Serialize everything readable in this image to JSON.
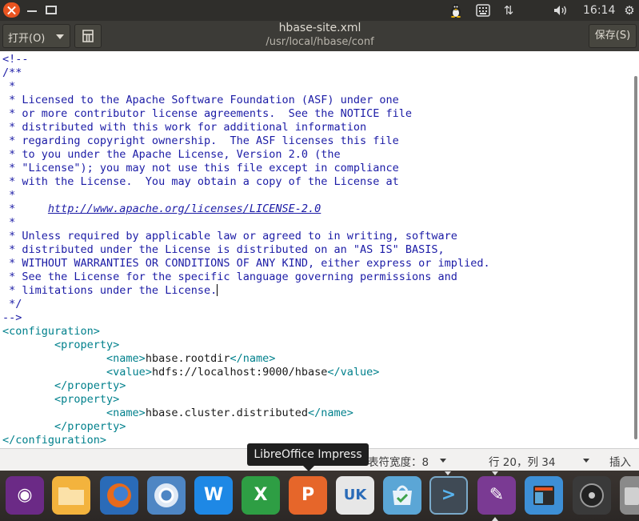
{
  "panel": {
    "clock": "16:14",
    "icons": [
      "tux-icon",
      "keyboard-icon",
      "network-icon",
      "volume-icon",
      "gear-icon"
    ]
  },
  "header": {
    "open_label": "打开(O)",
    "save_label": "保存(S)",
    "title": "hbase-site.xml",
    "subtitle": "/usr/local/hbase/conf"
  },
  "editor": {
    "lines": [
      [
        {
          "t": "<!--",
          "c": "cmt"
        }
      ],
      [
        {
          "t": "/**",
          "c": "cmt"
        }
      ],
      [
        {
          "t": " *",
          "c": "cmt"
        }
      ],
      [
        {
          "t": " * Licensed to the Apache Software Foundation (ASF) under one",
          "c": "cmt"
        }
      ],
      [
        {
          "t": " * or more contributor license agreements.  See the NOTICE file",
          "c": "cmt"
        }
      ],
      [
        {
          "t": " * distributed with this work for additional information",
          "c": "cmt"
        }
      ],
      [
        {
          "t": " * regarding copyright ownership.  The ASF licenses this file",
          "c": "cmt"
        }
      ],
      [
        {
          "t": " * to you under the Apache License, Version 2.0 (the",
          "c": "cmt"
        }
      ],
      [
        {
          "t": " * \"License\"); you may not use this file except in compliance",
          "c": "cmt"
        }
      ],
      [
        {
          "t": " * with the License.  You may obtain a copy of the License at",
          "c": "cmt"
        }
      ],
      [
        {
          "t": " *",
          "c": "cmt"
        }
      ],
      [
        {
          "t": " *     ",
          "c": "cmt"
        },
        {
          "t": "http://www.apache.org/licenses/LICENSE-2.0",
          "c": "lnk"
        }
      ],
      [
        {
          "t": " *",
          "c": "cmt"
        }
      ],
      [
        {
          "t": " * Unless required by applicable law or agreed to in writing, software",
          "c": "cmt"
        }
      ],
      [
        {
          "t": " * distributed under the License is distributed on an \"AS IS\" BASIS,",
          "c": "cmt"
        }
      ],
      [
        {
          "t": " * WITHOUT WARRANTIES OR CONDITIONS OF ANY KIND, either express or implied.",
          "c": "cmt"
        }
      ],
      [
        {
          "t": " * See the License for the specific language governing permissions and",
          "c": "cmt"
        }
      ],
      [
        {
          "t": " * limitations under the License.",
          "c": "cmt"
        },
        {
          "cursor": true
        }
      ],
      [
        {
          "t": " */",
          "c": "cmt"
        }
      ],
      [
        {
          "t": "-->",
          "c": "cmt"
        }
      ],
      [
        {
          "t": "<configuration>",
          "c": "tag"
        }
      ],
      [
        {
          "t": "        ",
          "c": "txt"
        },
        {
          "t": "<property>",
          "c": "tag"
        }
      ],
      [
        {
          "t": "                ",
          "c": "txt"
        },
        {
          "t": "<name>",
          "c": "tag"
        },
        {
          "t": "hbase.rootdir",
          "c": "txt"
        },
        {
          "t": "</name>",
          "c": "tag"
        }
      ],
      [
        {
          "t": "                ",
          "c": "txt"
        },
        {
          "t": "<value>",
          "c": "tag"
        },
        {
          "t": "hdfs://localhost:9000/hbase",
          "c": "txt"
        },
        {
          "t": "</value>",
          "c": "tag"
        }
      ],
      [
        {
          "t": "        ",
          "c": "txt"
        },
        {
          "t": "</property>",
          "c": "tag"
        }
      ],
      [
        {
          "t": "        ",
          "c": "txt"
        },
        {
          "t": "<property>",
          "c": "tag"
        }
      ],
      [
        {
          "t": "                ",
          "c": "txt"
        },
        {
          "t": "<name>",
          "c": "tag"
        },
        {
          "t": "hbase.cluster.distributed",
          "c": "txt"
        },
        {
          "t": "</name>",
          "c": "tag"
        }
      ],
      [
        {
          "t": "        ",
          "c": "txt"
        },
        {
          "t": "</property>",
          "c": "tag"
        }
      ],
      [
        {
          "t": "</configuration>",
          "c": "tag"
        }
      ]
    ]
  },
  "status": {
    "tab_width": "表符宽度：8",
    "position": "行 20，列 34",
    "mode": "插入"
  },
  "tooltip": "LibreOffice Impress",
  "dock": {
    "writer_glyph": "W",
    "calc_glyph": "X",
    "impress_glyph": "P",
    "langtool_glyph": "UK",
    "terminal_glyph": ">",
    "ubuntu_glyph": "◉",
    "pen_glyph": "✎"
  },
  "colors": {
    "comment": "#1b1ba6",
    "tag": "#00808c",
    "accent": "#e95420"
  }
}
